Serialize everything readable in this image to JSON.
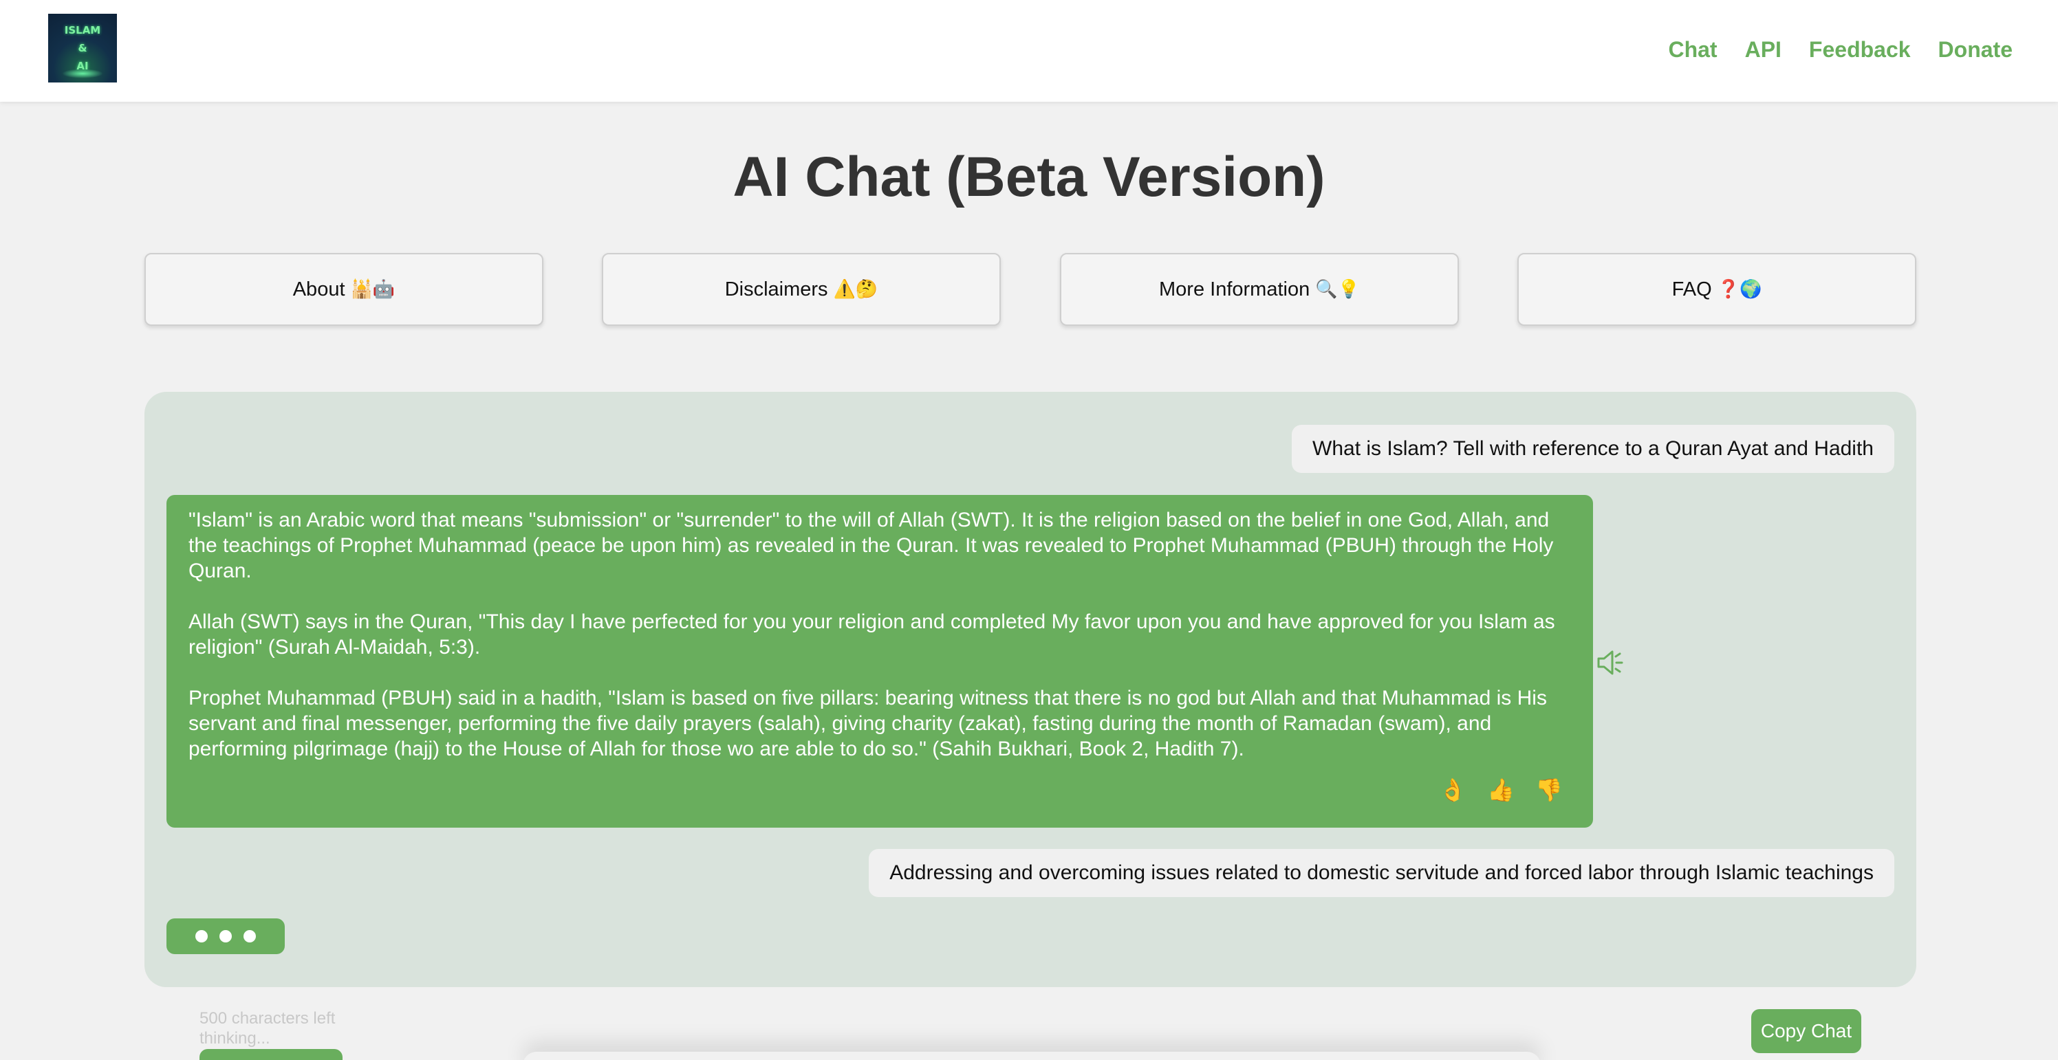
{
  "header": {
    "logo": {
      "line1": "ISLAM",
      "line2": "&",
      "line3": "AI"
    },
    "nav": [
      "Chat",
      "API",
      "Feedback",
      "Donate"
    ]
  },
  "page_title": "AI Chat (Beta Version)",
  "info_buttons": [
    {
      "label": "About",
      "emoji": "🕌🤖"
    },
    {
      "label": "Disclaimers",
      "emoji": "⚠️🤔"
    },
    {
      "label": "More Information",
      "emoji": "🔍💡"
    },
    {
      "label": "FAQ",
      "emoji": "❓🌍"
    }
  ],
  "chat": {
    "messages": [
      {
        "role": "user",
        "text": "What is Islam? Tell with reference to a Quran Ayat and Hadith"
      },
      {
        "role": "assistant",
        "paragraphs": [
          "\"Islam\" is an Arabic word that means \"submission\" or \"surrender\" to the will of Allah (SWT). It is the religion based on the belief in one God, Allah, and the teachings of Prophet Muhammad (peace be upon him) as revealed in the Quran. It  was revealed to Prophet Muhammad (PBUH) through the Holy Quran.",
          "Allah (SWT) says in the Quran, \"This day I have perfected for you your religion and completed My favor upon you and have approved for you Islam as religion\" (Surah Al-Maidah, 5:3).",
          "Prophet Muhammad (PBUH) said in a hadith, \"Islam is based on five pillars: bearing witness that there is no god but Allah and that Muhammad is His servant and final messenger, performing the five daily prayers (salah), giving charity (zakat), fasting during the month of Ramadan (swam), and performing pilgrimage (hajj) to the House of Allah for those wo are able to do so.\" (Sahih Bukhari, Book 2, Hadith 7)."
        ],
        "reactions": [
          "👌",
          "👍",
          "👎"
        ]
      },
      {
        "role": "user",
        "text": "Addressing and overcoming issues related to domestic servitude and forced labor through Islamic teachings"
      }
    ],
    "typing_indicator": true
  },
  "footer": {
    "chars_left": "500 characters left",
    "status": "thinking...",
    "copy_label": "Copy Chat"
  },
  "colors": {
    "accent": "#69ae5d",
    "panel_bg": "#d9e3dc",
    "page_bg": "#f1f1f1",
    "title_text": "#333333"
  },
  "icons": {
    "speaker": "speaker-icon"
  }
}
